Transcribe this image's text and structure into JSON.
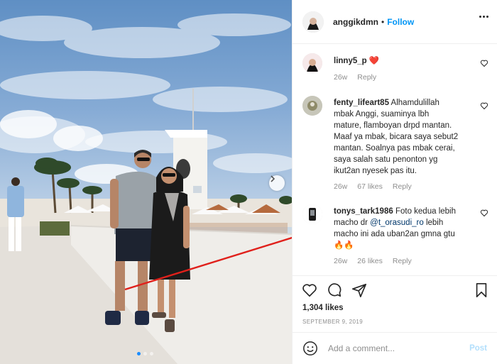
{
  "post_owner": {
    "username": "anggikdmn",
    "separator": "•",
    "follow_label": "Follow"
  },
  "comments": [
    {
      "username": "linny5_p",
      "text": "",
      "emoji": "❤️",
      "age": "26w",
      "likes": "",
      "reply_label": "Reply"
    },
    {
      "username": "fenty_lifeart85",
      "lines": [
        "Alhamdulillah",
        "mbak Anggi, suaminya lbh",
        "mature, flamboyan drpd mantan.",
        "Maaf ya mbak, bicara saya sebut2",
        "mantan. Soalnya pas mbak cerai,",
        "saya salah satu penonton yg",
        "ikut2an nyesek pas itu."
      ],
      "age": "26w",
      "likes": "67 likes",
      "reply_label": "Reply"
    },
    {
      "username": "tonys_tark1986",
      "line1": "Foto kedua lebih",
      "line2_pre": "macho dr ",
      "mention": "@t_orasudi_ro",
      "line2_post": " lebih",
      "line3": "macho ini ada uban2an gmna gtu",
      "emoji": "🔥🔥",
      "age": "26w",
      "likes": "26 likes",
      "reply_label": "Reply"
    }
  ],
  "post": {
    "likes": "1,304 likes",
    "date": "SEPTEMBER 9, 2019"
  },
  "composer": {
    "placeholder": "Add a comment...",
    "post_label": "Post"
  },
  "carousel": {
    "slides": 3,
    "active_slide": 1
  },
  "colors": {
    "link_blue": "#0095f6",
    "muted": "#8e8e8e",
    "annotation_arrow": "#e0201b",
    "heart": "#ed4956"
  },
  "icons": [
    "more-options-icon",
    "heart-icon",
    "comment-icon",
    "share-icon",
    "bookmark-icon",
    "emoji-icon",
    "chevron-right-icon"
  ]
}
